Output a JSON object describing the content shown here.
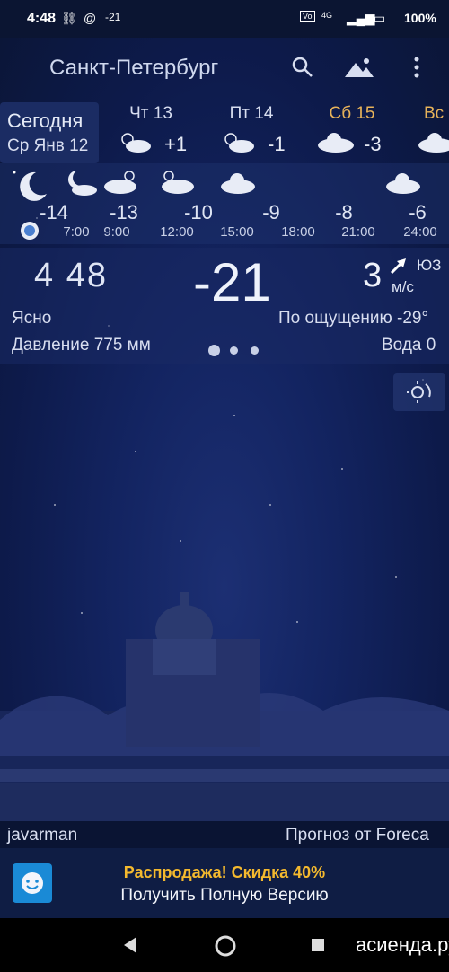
{
  "status": {
    "time": "4:48",
    "temp_badge": "-21",
    "network": "4G",
    "battery": "100%"
  },
  "header": {
    "city": "Санкт-Петербург",
    "icons": [
      "search-icon",
      "landscape-icon",
      "more-vert-icon"
    ]
  },
  "days": [
    {
      "name": "Сегодня",
      "date": "Ср Янв 12",
      "selected": true
    },
    {
      "name": "Чт 13",
      "temp": "+1",
      "icon": "partly-cloudy-icon"
    },
    {
      "name": "Пт 14",
      "temp": "-1",
      "icon": "partly-cloudy-icon"
    },
    {
      "name": "Сб 15",
      "temp": "-3",
      "icon": "cloud-icon",
      "color": "#e8b35a"
    },
    {
      "name": "Вс",
      "icon": "cloud-icon",
      "color": "#e8b35a"
    }
  ],
  "hourly": [
    {
      "temp": "-14",
      "time": "7:00",
      "icon": "moon-icon"
    },
    {
      "temp": "-13",
      "time": "9:00",
      "icon": "moon-cloud-icon"
    },
    {
      "temp": "-10",
      "time": "12:00",
      "icon": "partly-cloudy-icon"
    },
    {
      "temp": "-9",
      "time": "15:00",
      "icon": "cloud-icon"
    },
    {
      "temp": "-8",
      "time": "18:00",
      "icon": "cloud-icon"
    },
    {
      "temp": "-6",
      "time": "21:00",
      "icon": "cloud-icon"
    },
    {
      "temp": "",
      "time": "24:00",
      "icon": "cloud-icon"
    }
  ],
  "current": {
    "clock": "4  48",
    "temp": "-21",
    "wind_speed": "3",
    "wind_dir": "ЮЗ",
    "wind_unit": "м/с",
    "condition": "Ясно",
    "feels_like": "По ощущению -29°",
    "pressure": "Давление 775 мм",
    "water": "Вода 0"
  },
  "footer": {
    "author": "javarman",
    "provider": "Прогноз от Foreca",
    "promo_line1": "Распродажа! Скидка 40%",
    "promo_line2": "Получить Полную Версию"
  },
  "watermark": "асиенда.ру",
  "colors": {
    "accent": "#f4b92e",
    "weekend": "#e8b35a",
    "sky": "#132461"
  }
}
